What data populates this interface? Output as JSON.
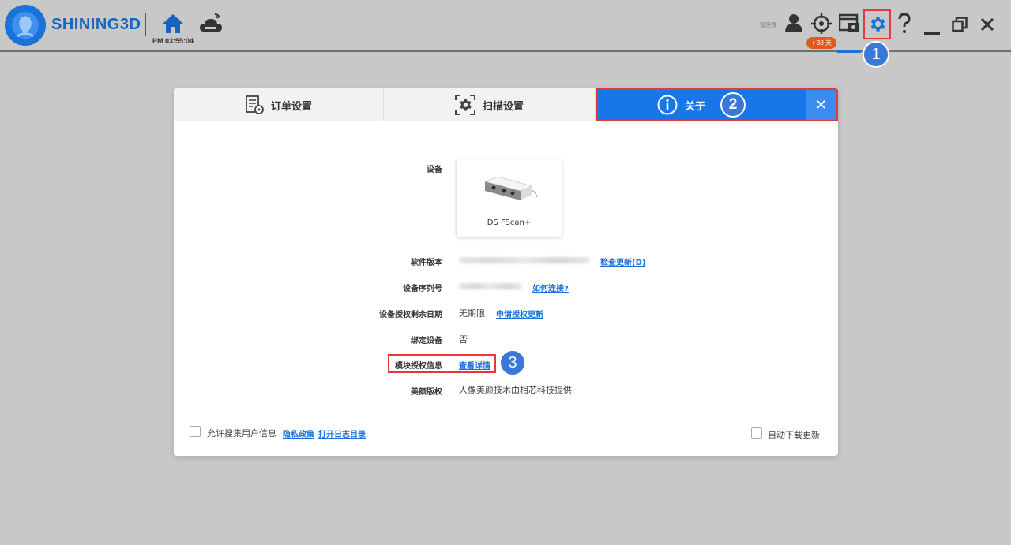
{
  "app": {
    "brand": "SHINING3D",
    "clock": "PM 03:55:04",
    "username": "管理员",
    "license_badge": "+ 38 天"
  },
  "steps": {
    "one": "1",
    "two": "2",
    "three": "3"
  },
  "dialog": {
    "tabs": [
      {
        "label": "订单设置",
        "icon": "order-settings-icon"
      },
      {
        "label": "扫描设置",
        "icon": "scan-settings-icon"
      },
      {
        "label": "关于",
        "icon": "info-icon"
      }
    ],
    "close_label": "✕",
    "rows": {
      "device_label": "设备",
      "device_name": "DS FScan+",
      "software_version_label": "软件版本",
      "check_update_link": "检查更新(D)",
      "serial_label": "设备序列号",
      "how_connect_link": "如何连接?",
      "license_label": "设备授权剩余日期",
      "license_value": "无期限",
      "apply_license_link": "申请授权更新",
      "bind_label": "绑定设备",
      "bind_value": "否",
      "module_label": "模块授权信息",
      "module_link": "查看详情",
      "beauty_label": "美颜版权",
      "beauty_value": "人像美颜技术由相芯科技提供"
    },
    "footer": {
      "collect_label": "允许搜集用户信息",
      "privacy_link": "隐私政策",
      "open_log_link": "打开日志目录",
      "auto_update_label": "自动下载更新"
    }
  },
  "colors": {
    "accent": "#1877e8",
    "highlight": "#e03a3a",
    "step_circle": "#3a78d8",
    "badge": "#e25a16"
  }
}
